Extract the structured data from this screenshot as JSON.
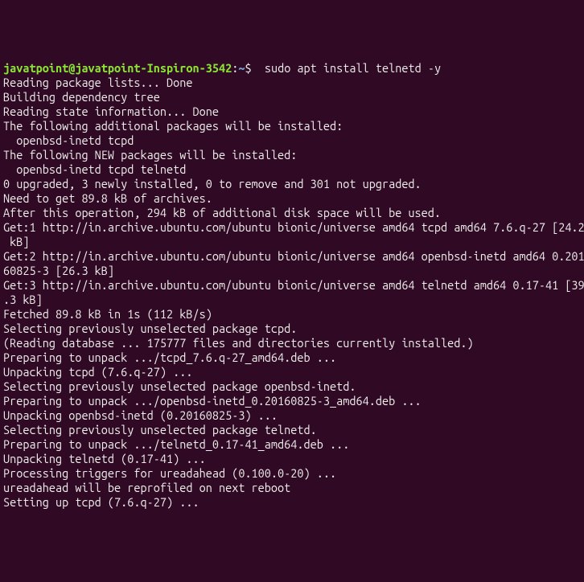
{
  "prompt": {
    "user_host": "javatpoint@javatpoint-Inspiron-3542",
    "colon": ":",
    "path": "~",
    "dollar": "$  ",
    "command": "sudo apt install telnetd -y"
  },
  "lines": [
    "Reading package lists... Done",
    "Building dependency tree",
    "Reading state information... Done",
    "The following additional packages will be installed:",
    "  openbsd-inetd tcpd",
    "The following NEW packages will be installed:",
    "  openbsd-inetd tcpd telnetd",
    "0 upgraded, 3 newly installed, 0 to remove and 301 not upgraded.",
    "Need to get 89.8 kB of archives.",
    "After this operation, 294 kB of additional disk space will be used.",
    "Get:1 http://in.archive.ubuntu.com/ubuntu bionic/universe amd64 tcpd amd64 7.6.q-27 [24.2 kB]",
    "Get:2 http://in.archive.ubuntu.com/ubuntu bionic/universe amd64 openbsd-inetd amd64 0.20160825-3 [26.3 kB]",
    "Get:3 http://in.archive.ubuntu.com/ubuntu bionic/universe amd64 telnetd amd64 0.17-41 [39.3 kB]",
    "Fetched 89.8 kB in 1s (112 kB/s)",
    "Selecting previously unselected package tcpd.",
    "(Reading database ... 175777 files and directories currently installed.)",
    "Preparing to unpack .../tcpd_7.6.q-27_amd64.deb ...",
    "Unpacking tcpd (7.6.q-27) ...",
    "Selecting previously unselected package openbsd-inetd.",
    "Preparing to unpack .../openbsd-inetd_0.20160825-3_amd64.deb ...",
    "Unpacking openbsd-inetd (0.20160825-3) ...",
    "Selecting previously unselected package telnetd.",
    "Preparing to unpack .../telnetd_0.17-41_amd64.deb ...",
    "Unpacking telnetd (0.17-41) ...",
    "Processing triggers for ureadahead (0.100.0-20) ...",
    "ureadahead will be reprofiled on next reboot",
    "Setting up tcpd (7.6.q-27) ..."
  ]
}
